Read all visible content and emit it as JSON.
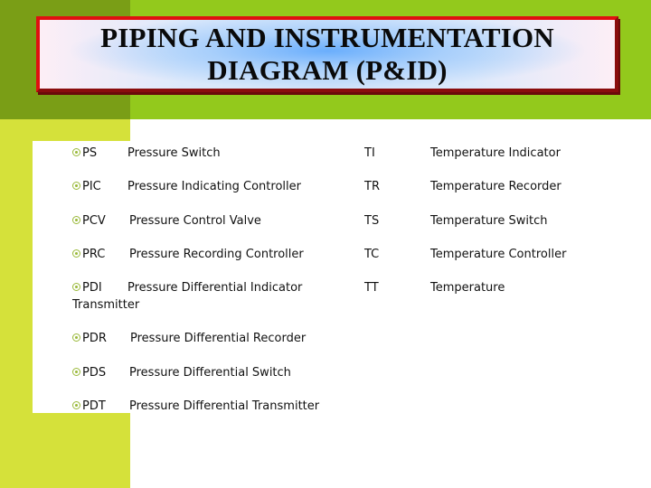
{
  "title": {
    "line1": "PIPING AND INSTRUMENTATION",
    "line2": "DIAGRAM (P&ID)"
  },
  "colors": {
    "olive": "#7a9e16",
    "green": "#93c91c",
    "lime": "#d5e13a",
    "title_border": "#e01010",
    "bullet": "#9ab93a"
  },
  "bullet_icon": "target-circle-icon",
  "pressure_items": [
    {
      "abbr": "PS",
      "desc": "Pressure Switch"
    },
    {
      "abbr": "PIC",
      "desc": "Pressure Indicating Controller"
    },
    {
      "abbr": "PCV",
      "desc": "Pressure Control Valve"
    },
    {
      "abbr": "PRC",
      "desc": "Pressure Recording Controller"
    },
    {
      "abbr": "PDI",
      "desc": "Pressure Differential Indicator",
      "desc_cont": "Transmitter"
    },
    {
      "abbr": "PDR",
      "desc": "Pressure Differential Recorder"
    },
    {
      "abbr": "PDS",
      "desc": "Pressure Differential Switch"
    },
    {
      "abbr": "PDT",
      "desc": "Pressure Differential Transmitter"
    }
  ],
  "temperature_items": [
    {
      "abbr": "TI",
      "desc": "Temperature Indicator"
    },
    {
      "abbr": "TR",
      "desc": "Temperature Recorder"
    },
    {
      "abbr": "TS",
      "desc": "Temperature Switch"
    },
    {
      "abbr": "TC",
      "desc": "Temperature Controller"
    },
    {
      "abbr": "TT",
      "desc": "Temperature"
    }
  ]
}
